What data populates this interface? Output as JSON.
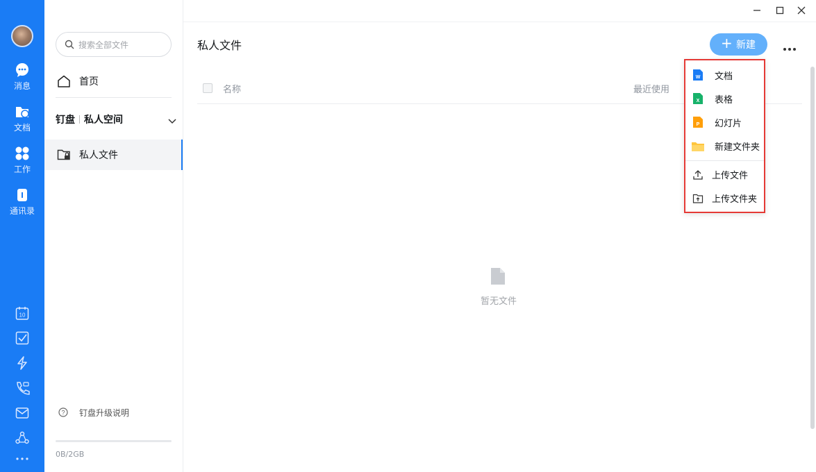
{
  "rail": {
    "items": [
      {
        "label": "消息",
        "icon": "message-icon"
      },
      {
        "label": "文档",
        "icon": "docs-icon"
      },
      {
        "label": "工作",
        "icon": "work-icon"
      },
      {
        "label": "通讯录",
        "icon": "contacts-icon"
      }
    ],
    "tools": [
      "calendar-icon",
      "todo-icon",
      "ding-icon",
      "call-icon",
      "mail-icon",
      "org-icon",
      "more-icon"
    ],
    "calendar_day": "10"
  },
  "nav": {
    "search_placeholder": "搜索全部文件",
    "home_label": "首页",
    "section_left": "钉盘",
    "section_right": "私人空间",
    "private_files": "私人文件",
    "upgrade_label": "钉盘升级说明",
    "storage_text": "0B/2GB",
    "storage_used_fraction": 0
  },
  "main": {
    "title": "私人文件",
    "new_button": "新建",
    "columns": {
      "name": "名称",
      "recent": "最近使用"
    },
    "empty_text": "暂无文件"
  },
  "menu": {
    "items": [
      {
        "label": "文档",
        "icon": "word-doc-icon",
        "color": "#1a7cf5",
        "letter": "W"
      },
      {
        "label": "表格",
        "icon": "sheet-icon",
        "color": "#17b26a",
        "letter": "X"
      },
      {
        "label": "幻灯片",
        "icon": "slides-icon",
        "color": "#ff9f0a",
        "letter": "P"
      },
      {
        "label": "新建文件夹",
        "icon": "folder-icon",
        "color": "#ffc53d"
      },
      {
        "label": "上传文件",
        "icon": "upload-file-icon"
      },
      {
        "label": "上传文件夹",
        "icon": "upload-folder-icon"
      }
    ]
  },
  "colors": {
    "brand": "#1a7cf5",
    "highlight": "#e53935"
  }
}
